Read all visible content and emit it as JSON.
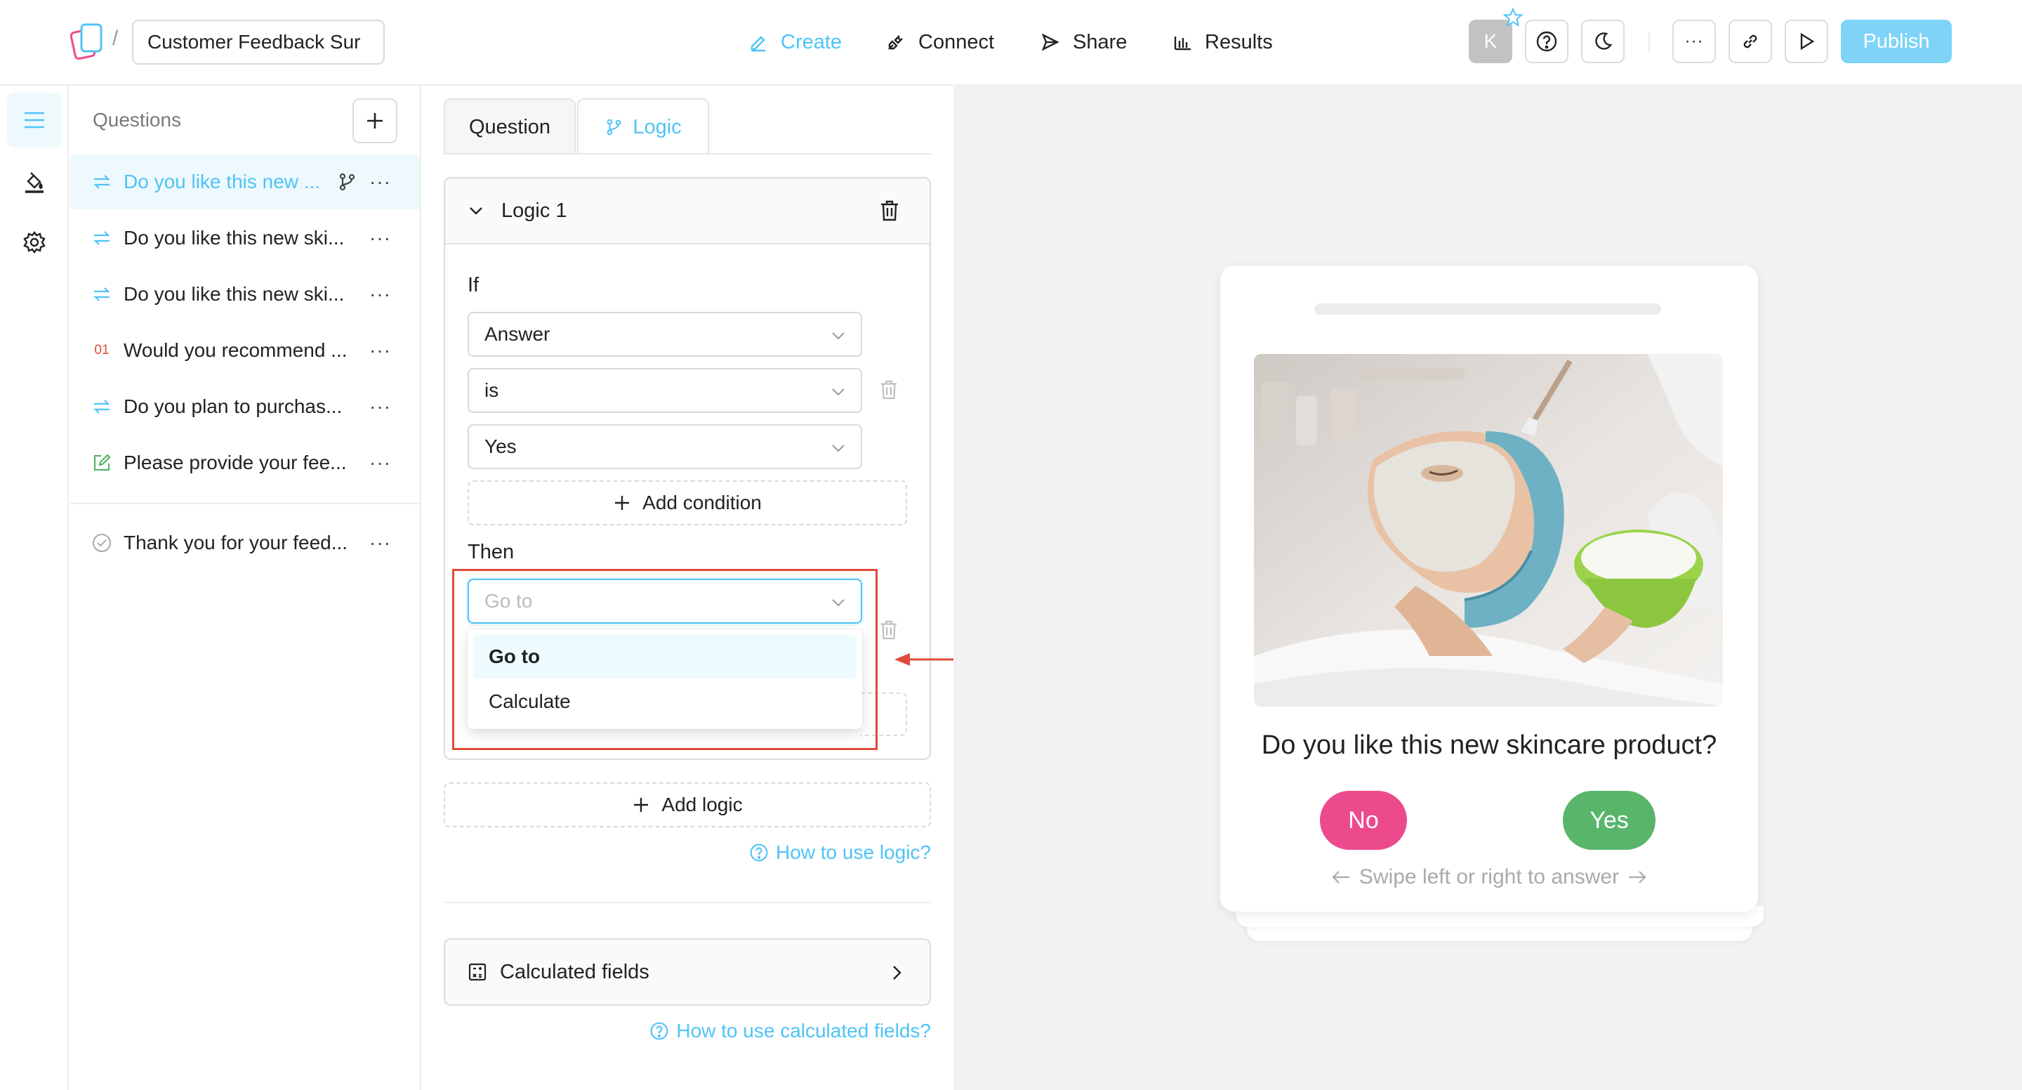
{
  "header": {
    "survey_title": "Customer Feedback Sur",
    "breadcrumb_separator": "/",
    "nav": {
      "create": "Create",
      "connect": "Connect",
      "share": "Share",
      "results": "Results"
    },
    "avatar_initial": "K",
    "publish_label": "Publish",
    "more_glyph": "···"
  },
  "questions": {
    "header": "Questions",
    "items": [
      {
        "label": "Do you like this new ...",
        "icon": "swap-icon",
        "selected": true,
        "has_branch": true
      },
      {
        "label": "Do you like this new ski...",
        "icon": "swap-icon"
      },
      {
        "label": "Do you like this new ski...",
        "icon": "swap-icon"
      },
      {
        "label": "Would you recommend ...",
        "icon": "number-icon",
        "badge": "01"
      },
      {
        "label": "Do you plan to purchas...",
        "icon": "swap-icon"
      },
      {
        "label": "Please provide your fee...",
        "icon": "edit-icon"
      }
    ],
    "ending": {
      "label": "Thank you for your feed...",
      "icon": "check-circle-icon"
    },
    "more_glyph": "···"
  },
  "panel": {
    "tabs": {
      "question": "Question",
      "logic": "Logic"
    },
    "logic": {
      "title": "Logic 1",
      "if_label": "If",
      "condition": {
        "field": "Answer",
        "operator": "is",
        "value": "Yes"
      },
      "add_condition": "Add condition",
      "then_label": "Then",
      "action_placeholder": "Go to",
      "action_options": [
        "Go to",
        "Calculate"
      ],
      "highlighted_option": "Go to"
    },
    "add_logic": "Add logic",
    "help_logic": "How to use logic?",
    "calculated_fields": "Calculated fields",
    "help_calculated": "How to use calculated fields?"
  },
  "preview": {
    "question": "Do you like this new skincare product?",
    "answer_no": "No",
    "answer_yes": "Yes",
    "swipe_hint": "Swipe left or right to answer",
    "colors": {
      "no": "#ec4a8d",
      "yes": "#58b56a",
      "accent": "#4fc3f7",
      "annotation": "#e04a3a"
    }
  }
}
